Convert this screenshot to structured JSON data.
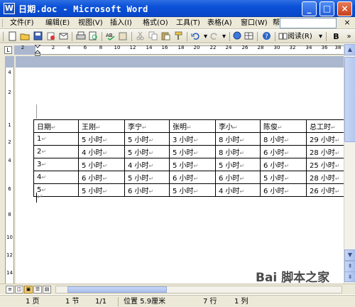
{
  "window": {
    "app_icon": "W",
    "title": "日期.doc - Microsoft Word",
    "buttons": {
      "minimize": "_",
      "maximize": "□",
      "close": "×"
    }
  },
  "menu": {
    "items": [
      "文件(F)",
      "编辑(E)",
      "视图(V)",
      "插入(I)",
      "格式(O)",
      "工具(T)",
      "表格(A)",
      "窗口(W)",
      "帮助(H)"
    ],
    "close": "×"
  },
  "toolbar": {
    "read_label": "阅读(R)",
    "bold": "B"
  },
  "ruler": {
    "corner": "L",
    "ticks": [
      "2",
      "2",
      "4",
      "6",
      "8",
      "10",
      "12",
      "14",
      "16",
      "18",
      "20",
      "22",
      "24",
      "26",
      "28",
      "30",
      "32",
      "34",
      "36",
      "38"
    ],
    "vticks": [
      "4",
      "2",
      "1",
      "2",
      "4",
      "6",
      "8",
      "10",
      "12",
      "14"
    ]
  },
  "table": {
    "header": [
      "日期",
      "王刚",
      "李宁",
      "张明",
      "李小",
      "陈俊",
      "总工时"
    ],
    "rows": [
      [
        "1",
        "5 小时",
        "5 小时",
        "3 小时",
        "8 小时",
        "8 小时",
        "29 小时"
      ],
      [
        "2",
        "4 小时",
        "5 小时",
        "5 小时",
        "8 小时",
        "6 小时",
        "28 小时"
      ],
      [
        "3",
        "5 小时",
        "4 小时",
        "5 小时",
        "5 小时",
        "6 小时",
        "25 小时"
      ],
      [
        "4",
        "6 小时",
        "5 小时",
        "6 小时",
        "6 小时",
        "5 小时",
        "28 小时"
      ],
      [
        "5",
        "5 小时",
        "6 小时",
        "5 小时",
        "4 小时",
        "6 小时",
        "26 小时"
      ]
    ],
    "cell_mark": "↵",
    "row_end_mark": "↵"
  },
  "status": {
    "page": "1 页",
    "section": "1 节",
    "pages": "1/1",
    "position": "位置 5.9厘米",
    "line": "7 行",
    "column": "1 列"
  },
  "watermark": {
    "text": "脚本之家",
    "brand": "Bai"
  },
  "colors": {
    "titlebar": "#0b51d8",
    "chrome": "#ece9d8",
    "ruler_margin": "#aab7cf"
  }
}
